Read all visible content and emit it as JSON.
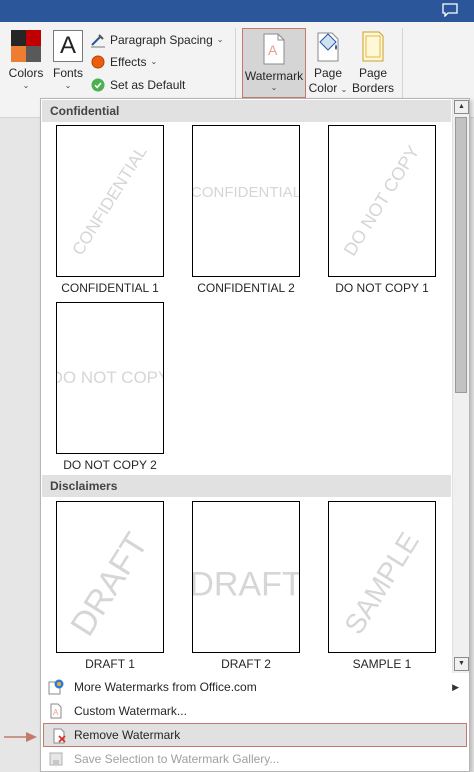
{
  "ribbon": {
    "colors_label": "Colors",
    "fonts_label": "Fonts",
    "font_glyph": "A",
    "paragraph_spacing_label": "Paragraph Spacing",
    "effects_label": "Effects",
    "set_default_label": "Set as Default",
    "watermark_label": "Watermark",
    "page_color_line1": "Page",
    "page_color_line2": "Color",
    "page_borders_line1": "Page",
    "page_borders_line2": "Borders",
    "chevron": "⌄"
  },
  "gallery": {
    "sections": [
      {
        "header": "Confidential",
        "items": [
          {
            "label": "CONFIDENTIAL 1",
            "watermark": "CONFIDENTIAL",
            "style": "diagonal"
          },
          {
            "label": "CONFIDENTIAL 2",
            "watermark": "CONFIDENTIAL",
            "style": "horizontal"
          },
          {
            "label": "DO NOT COPY 1",
            "watermark": "DO NOT COPY",
            "style": "diagonal"
          },
          {
            "label": "DO NOT COPY 2",
            "watermark": "DO NOT COPY",
            "style": "horizontal"
          }
        ]
      },
      {
        "header": "Disclaimers",
        "items": [
          {
            "label": "DRAFT 1",
            "watermark": "DRAFT",
            "style": "diagonal-large"
          },
          {
            "label": "DRAFT 2",
            "watermark": "DRAFT",
            "style": "horizontal-large"
          },
          {
            "label": "SAMPLE 1",
            "watermark": "SAMPLE",
            "style": "diagonal-large"
          }
        ]
      }
    ]
  },
  "menu": {
    "more_watermarks": "More Watermarks from Office.com",
    "custom_watermark": "Custom Watermark...",
    "remove_watermark": "Remove Watermark",
    "save_selection": "Save Selection to Watermark Gallery..."
  },
  "colors": {
    "accent_red": "#c47a6a",
    "title_blue": "#2b579a"
  }
}
